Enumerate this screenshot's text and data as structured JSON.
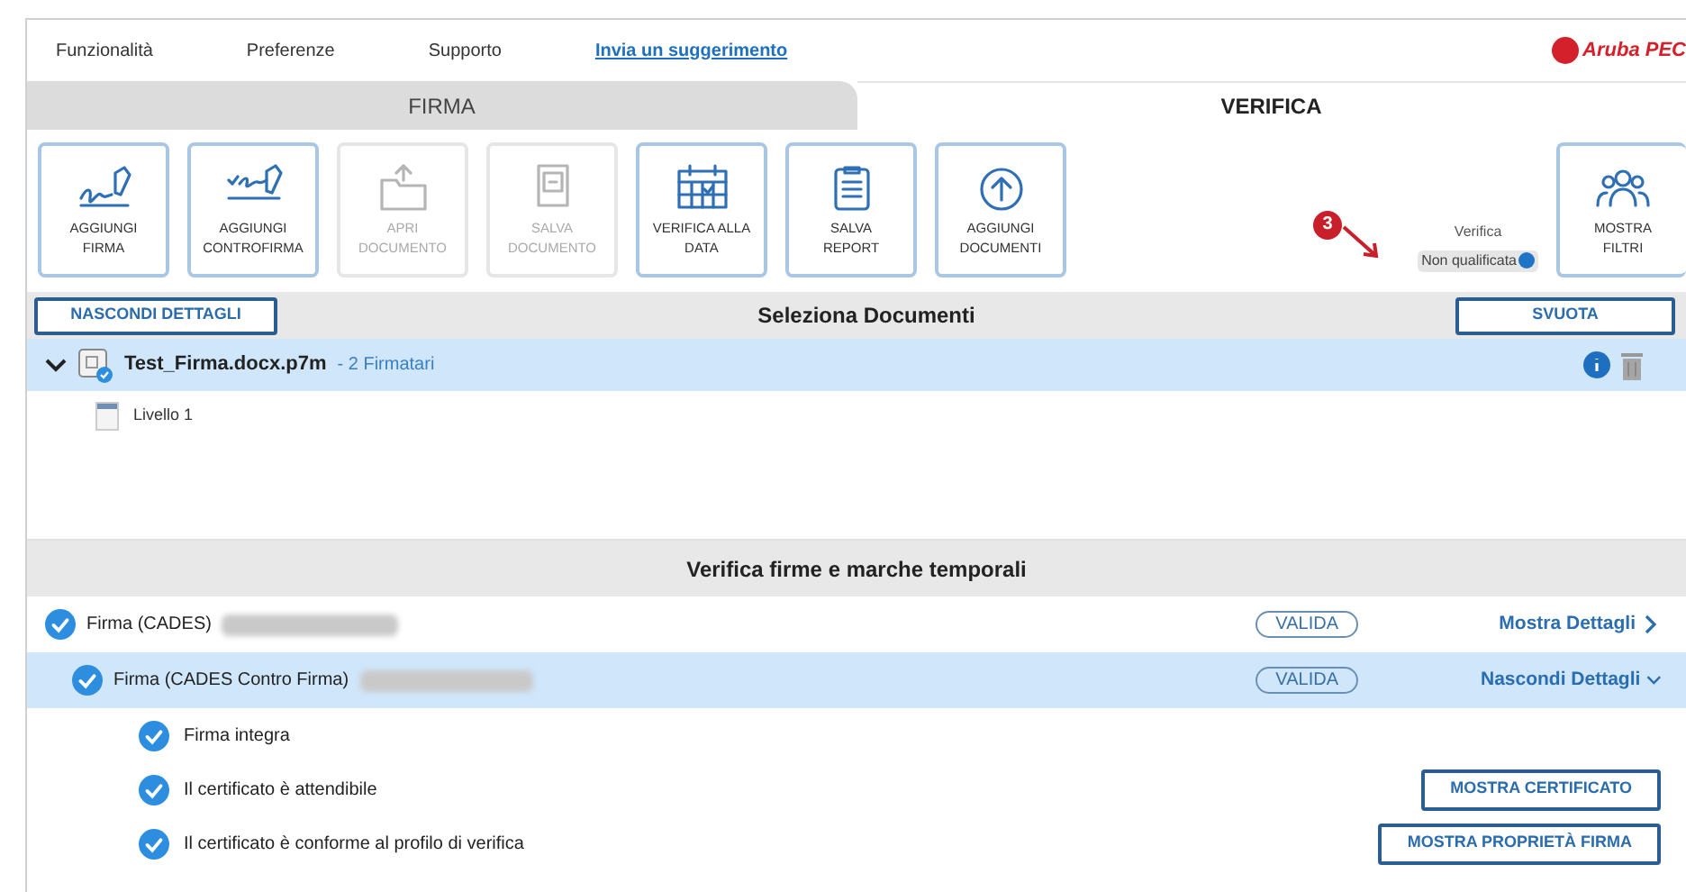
{
  "menu": [
    {
      "label": "Funzionalità",
      "kind": "menu"
    },
    {
      "label": "Preferenze",
      "kind": "menu"
    },
    {
      "label": "Supporto",
      "kind": "menu"
    },
    {
      "label": "Invia un suggerimento",
      "kind": "link"
    }
  ],
  "logo": {
    "text": "Aruba PEC"
  },
  "tabs": [
    {
      "label": "FIRMA",
      "selected": false
    },
    {
      "label": "VERIFICA",
      "selected": true
    }
  ],
  "toolbar": [
    {
      "label": "AGGIUNGI\nFIRMA",
      "kind": "signature",
      "disabled": false
    },
    {
      "label": "AGGIUNGI\nCONTROFIRMA",
      "kind": "countersign",
      "disabled": false
    },
    {
      "label": "APRI\nDOCUMENTO",
      "kind": "folder",
      "disabled": true
    },
    {
      "label": "SALVA\nDOCUMENTO",
      "kind": "save",
      "disabled": true
    },
    {
      "label": "VERIFICA ALLA\nDATA",
      "kind": "calendar",
      "disabled": false
    },
    {
      "label": "SALVA\nREPORT",
      "kind": "report",
      "disabled": false
    },
    {
      "label": "AGGIUNGI\nDOCUMENTI",
      "kind": "upload",
      "disabled": false
    }
  ],
  "annotation": {
    "number": "3"
  },
  "verify_mode": {
    "label": "Verifica",
    "value": "Non qualificata"
  },
  "filter_button": {
    "label": "MOSTRA\nFILTRI"
  },
  "documents": {
    "title": "Seleziona Documenti",
    "left_button": "NASCONDI DETTAGLI",
    "right_button": "SVUOTA",
    "items": [
      {
        "name": "Test_Firma.docx.p7m",
        "signers": "- 2 Firmatari",
        "expanded": true,
        "selected": true,
        "children": [
          {
            "label": "Livello 1"
          }
        ]
      }
    ]
  },
  "verification": {
    "title": "Verifica firme e marche temporali",
    "signatures": [
      {
        "label": "Firma (CADES)",
        "status": "VALIDA",
        "action": "Mostra Dettagli",
        "expanded": false,
        "selected": false
      },
      {
        "label": "Firma (CADES Contro Firma)",
        "status": "VALIDA",
        "action": "Nascondi Dettagli",
        "expanded": true,
        "selected": true,
        "checks": [
          {
            "label": "Firma integra"
          },
          {
            "label": "Il certificato è attendibile",
            "button": "MOSTRA CERTIFICATO"
          },
          {
            "label": "Il certificato è conforme al profilo di verifica",
            "button": "MOSTRA PROPRIETÀ FIRMA"
          }
        ]
      }
    ]
  }
}
